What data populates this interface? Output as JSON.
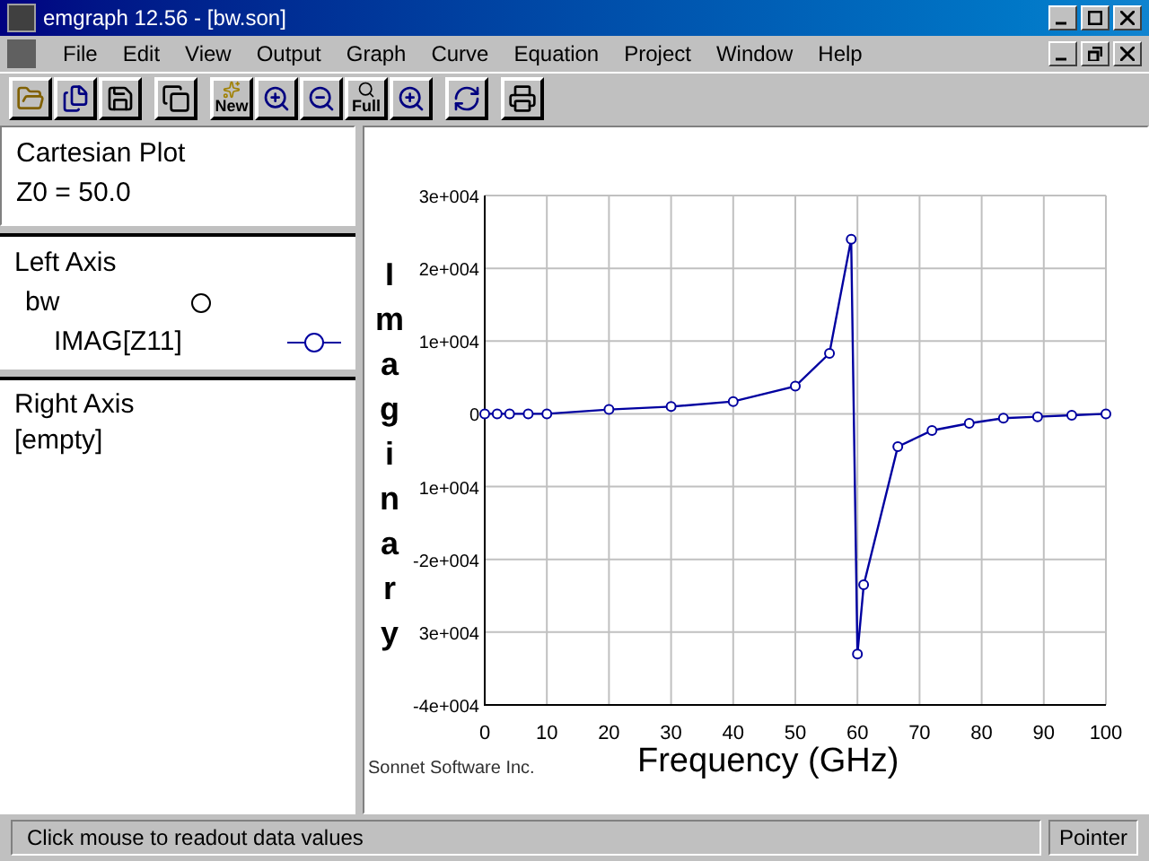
{
  "window": {
    "title": "emgraph 12.56 - [bw.son]"
  },
  "menu": [
    "File",
    "Edit",
    "View",
    "Output",
    "Graph",
    "Curve",
    "Equation",
    "Project",
    "Window",
    "Help"
  ],
  "toolbar": [
    [
      {
        "kind": "open"
      },
      {
        "kind": "files"
      },
      {
        "kind": "save"
      }
    ],
    [
      {
        "kind": "copy"
      }
    ],
    [
      {
        "kind": "new",
        "text": "New"
      },
      {
        "kind": "zoom-in"
      },
      {
        "kind": "zoom-out"
      },
      {
        "kind": "full",
        "text": "Full"
      },
      {
        "kind": "zoom-both"
      }
    ],
    [
      {
        "kind": "refresh"
      }
    ],
    [
      {
        "kind": "print"
      }
    ]
  ],
  "info": {
    "title": "Cartesian Plot",
    "z0": "Z0 = 50.0"
  },
  "left_axis": {
    "title": "Left Axis",
    "file": "bw"
  },
  "right_axis": {
    "title": "Right Axis",
    "content": "[empty]"
  },
  "plot": {
    "credit": "Sonnet Software Inc.",
    "chart_data": {
      "type": "line",
      "grid": true,
      "xlabel": "Frequency (GHz)",
      "ylabel": "Imaginary",
      "xlim": [
        0,
        100
      ],
      "ylim": [
        -40000,
        30000
      ],
      "xticks": [
        0,
        10,
        20,
        30,
        40,
        50,
        60,
        70,
        80,
        90,
        100
      ],
      "yticks": [
        {
          "value": 30000,
          "label": "3e+004"
        },
        {
          "value": 20000,
          "label": "2e+004"
        },
        {
          "value": 10000,
          "label": "1e+004"
        },
        {
          "value": 0,
          "label": "0"
        },
        {
          "value": -10000,
          "label": "1e+004"
        },
        {
          "value": -20000,
          "label": "-2e+004"
        },
        {
          "value": -30000,
          "label": "3e+004"
        },
        {
          "value": -40000,
          "label": "-4e+004"
        }
      ],
      "x": [
        0,
        2,
        4,
        7,
        10,
        20,
        30,
        40,
        50,
        55.5,
        59,
        60,
        61,
        66.5,
        72,
        78,
        83.5,
        89,
        94.5,
        100
      ],
      "series": [
        {
          "name": "IMAG[Z11]",
          "color": "#0000a0",
          "marker": "o",
          "values": [
            0,
            0,
            0,
            0,
            0,
            600,
            1000,
            1700,
            3800,
            8300,
            24000,
            -33000,
            -23500,
            -4500,
            -2300,
            -1300,
            -600,
            -400,
            -200,
            0
          ]
        }
      ]
    }
  },
  "status_bar": {
    "message": "Click mouse to readout data values",
    "mode": "Pointer"
  }
}
